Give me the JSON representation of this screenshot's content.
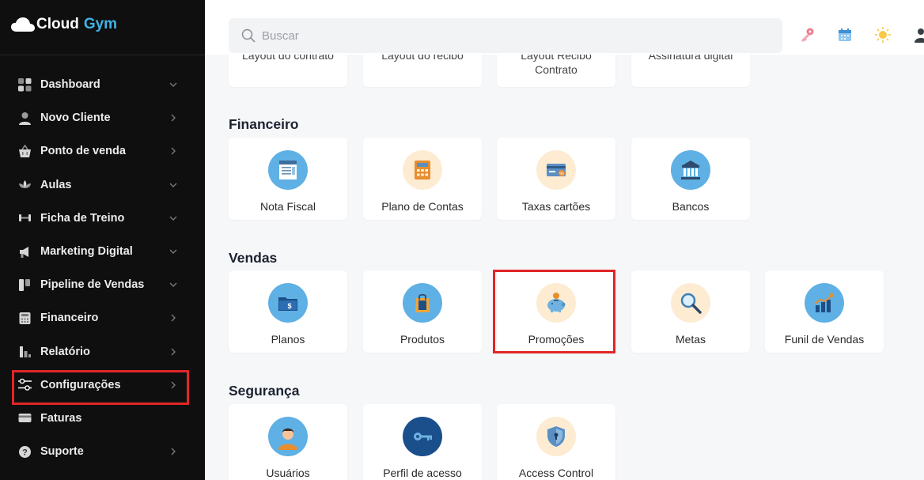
{
  "brand": {
    "word1": "Cloud",
    "word2": "Gym",
    "accent": "#3fb4e6"
  },
  "sidebar": {
    "items": [
      {
        "label": "Dashboard",
        "icon": "dashboard-icon",
        "chevron": "down"
      },
      {
        "label": "Novo Cliente",
        "icon": "user-icon",
        "chevron": "right"
      },
      {
        "label": "Ponto de venda",
        "icon": "basket-icon",
        "chevron": "right"
      },
      {
        "label": "Aulas",
        "icon": "lotus-icon",
        "chevron": "down"
      },
      {
        "label": "Ficha de Treino",
        "icon": "dumbbell-icon",
        "chevron": "down"
      },
      {
        "label": "Marketing Digital",
        "icon": "megaphone-icon",
        "chevron": "down"
      },
      {
        "label": "Pipeline de Vendas",
        "icon": "pipeline-icon",
        "chevron": "down"
      },
      {
        "label": "Financeiro",
        "icon": "calculator-icon",
        "chevron": "right"
      },
      {
        "label": "Relatório",
        "icon": "bar-chart-icon",
        "chevron": "right"
      },
      {
        "label": "Configurações",
        "icon": "sliders-icon",
        "chevron": "right"
      },
      {
        "label": "Faturas",
        "icon": "credit-card-icon",
        "chevron": ""
      },
      {
        "label": "Suporte",
        "icon": "help-icon",
        "chevron": "right"
      }
    ]
  },
  "search": {
    "placeholder": "Buscar"
  },
  "header_icons": [
    "key-icon",
    "calendar-icon",
    "sun-icon",
    "user-profile-icon"
  ],
  "sections": {
    "previous": {
      "cards": [
        "Layout do contrato",
        "Layout do recibo",
        "Layout Recibo Contrato",
        "Assinatura digital"
      ]
    },
    "financeiro": {
      "title": "Financeiro",
      "cards": [
        "Nota Fiscal",
        "Plano de Contas",
        "Taxas cartões",
        "Bancos"
      ]
    },
    "vendas": {
      "title": "Vendas",
      "cards": [
        "Planos",
        "Produtos",
        "Promoções",
        "Metas",
        "Funil de Vendas"
      ]
    },
    "seguranca": {
      "title": "Segurança",
      "cards": [
        "Usuários",
        "Perfil de acesso",
        "Access Control"
      ]
    }
  },
  "highlight_color": "#e12626"
}
